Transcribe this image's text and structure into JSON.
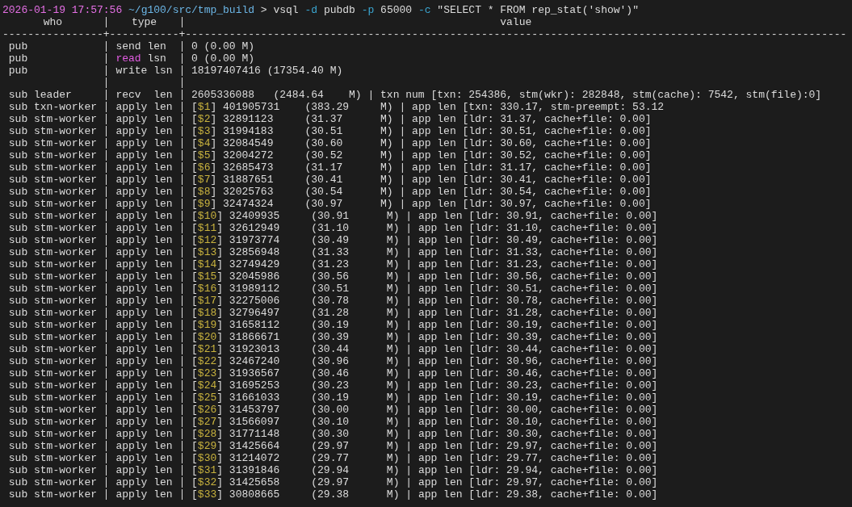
{
  "prompt": {
    "timestamp": "2026-01-19 17:57:56",
    "path": "~/g100/src/tmp_build",
    "symbol": ">",
    "command": [
      {
        "text": "vsql ",
        "kind": "plain"
      },
      {
        "text": "-d",
        "kind": "flag"
      },
      {
        "text": " pubdb ",
        "kind": "plain"
      },
      {
        "text": "-p",
        "kind": "flag"
      },
      {
        "text": " 65000 ",
        "kind": "plain"
      },
      {
        "text": "-c",
        "kind": "flag"
      },
      {
        "text": " \"SELECT * FROM rep_stat('show')\"",
        "kind": "plain"
      }
    ]
  },
  "table": {
    "columns": [
      "who",
      "type",
      "value"
    ],
    "rule": "----------------+-----------+---------------------------------------------------------------------------------------------------------",
    "rows": [
      {
        "kind": "data",
        "who": "pub",
        "type": "send len",
        "value": "0 (0.00 M)"
      },
      {
        "kind": "data",
        "who": "pub",
        "type": [
          {
            "text": "read",
            "kind": "keyword"
          },
          {
            "text": " lsn",
            "kind": "plain"
          }
        ],
        "value": "0 (0.00 M)"
      },
      {
        "kind": "data",
        "who": "pub",
        "type": "write lsn",
        "value": "18197407416 (17354.40 M)"
      },
      {
        "kind": "blank"
      },
      {
        "kind": "data",
        "who": "sub leader",
        "type": "recv  len",
        "value": "2605336088   (2484.64    M) | txn num [txn: 254386, stm(wkr): 282848, stm(cache): 7542, stm(file):0]"
      },
      {
        "kind": "data",
        "who": "sub txn-worker",
        "type": "apply len",
        "value": [
          {
            "text": "[",
            "kind": "plain"
          },
          {
            "text": "$1",
            "kind": "param"
          },
          {
            "text": "] 401905731    (383.29     M) | app len [txn: 330.17, stm-preempt: 53.12",
            "kind": "plain"
          }
        ]
      },
      {
        "kind": "data",
        "who": "sub stm-worker",
        "type": "apply len",
        "value": [
          {
            "text": "[",
            "kind": "plain"
          },
          {
            "text": "$2",
            "kind": "param"
          },
          {
            "text": "] 32891123     (31.37      M) | app len [ldr: 31.37, cache+file: 0.00]",
            "kind": "plain"
          }
        ]
      },
      {
        "kind": "data",
        "who": "sub stm-worker",
        "type": "apply len",
        "value": [
          {
            "text": "[",
            "kind": "plain"
          },
          {
            "text": "$3",
            "kind": "param"
          },
          {
            "text": "] 31994183     (30.51      M) | app len [ldr: 30.51, cache+file: 0.00]",
            "kind": "plain"
          }
        ]
      },
      {
        "kind": "data",
        "who": "sub stm-worker",
        "type": "apply len",
        "value": [
          {
            "text": "[",
            "kind": "plain"
          },
          {
            "text": "$4",
            "kind": "param"
          },
          {
            "text": "] 32084549     (30.60      M) | app len [ldr: 30.60, cache+file: 0.00]",
            "kind": "plain"
          }
        ]
      },
      {
        "kind": "data",
        "who": "sub stm-worker",
        "type": "apply len",
        "value": [
          {
            "text": "[",
            "kind": "plain"
          },
          {
            "text": "$5",
            "kind": "param"
          },
          {
            "text": "] 32004272     (30.52      M) | app len [ldr: 30.52, cache+file: 0.00]",
            "kind": "plain"
          }
        ]
      },
      {
        "kind": "data",
        "who": "sub stm-worker",
        "type": "apply len",
        "value": [
          {
            "text": "[",
            "kind": "plain"
          },
          {
            "text": "$6",
            "kind": "param"
          },
          {
            "text": "] 32685473     (31.17      M) | app len [ldr: 31.17, cache+file: 0.00]",
            "kind": "plain"
          }
        ]
      },
      {
        "kind": "data",
        "who": "sub stm-worker",
        "type": "apply len",
        "value": [
          {
            "text": "[",
            "kind": "plain"
          },
          {
            "text": "$7",
            "kind": "param"
          },
          {
            "text": "] 31887651     (30.41      M) | app len [ldr: 30.41, cache+file: 0.00]",
            "kind": "plain"
          }
        ]
      },
      {
        "kind": "data",
        "who": "sub stm-worker",
        "type": "apply len",
        "value": [
          {
            "text": "[",
            "kind": "plain"
          },
          {
            "text": "$8",
            "kind": "param"
          },
          {
            "text": "] 32025763     (30.54      M) | app len [ldr: 30.54, cache+file: 0.00]",
            "kind": "plain"
          }
        ]
      },
      {
        "kind": "data",
        "who": "sub stm-worker",
        "type": "apply len",
        "value": [
          {
            "text": "[",
            "kind": "plain"
          },
          {
            "text": "$9",
            "kind": "param"
          },
          {
            "text": "] 32474324     (30.97      M) | app len [ldr: 30.97, cache+file: 0.00]",
            "kind": "plain"
          }
        ]
      },
      {
        "kind": "data",
        "who": "sub stm-worker",
        "type": "apply len",
        "value": [
          {
            "text": "[",
            "kind": "plain"
          },
          {
            "text": "$10",
            "kind": "param"
          },
          {
            "text": "] 32409935     (30.91      M) | app len [ldr: 30.91, cache+file: 0.00]",
            "kind": "plain"
          }
        ]
      },
      {
        "kind": "data",
        "who": "sub stm-worker",
        "type": "apply len",
        "value": [
          {
            "text": "[",
            "kind": "plain"
          },
          {
            "text": "$11",
            "kind": "param"
          },
          {
            "text": "] 32612949     (31.10      M) | app len [ldr: 31.10, cache+file: 0.00]",
            "kind": "plain"
          }
        ]
      },
      {
        "kind": "data",
        "who": "sub stm-worker",
        "type": "apply len",
        "value": [
          {
            "text": "[",
            "kind": "plain"
          },
          {
            "text": "$12",
            "kind": "param"
          },
          {
            "text": "] 31973774     (30.49      M) | app len [ldr: 30.49, cache+file: 0.00]",
            "kind": "plain"
          }
        ]
      },
      {
        "kind": "data",
        "who": "sub stm-worker",
        "type": "apply len",
        "value": [
          {
            "text": "[",
            "kind": "plain"
          },
          {
            "text": "$13",
            "kind": "param"
          },
          {
            "text": "] 32856948     (31.33      M) | app len [ldr: 31.33, cache+file: 0.00]",
            "kind": "plain"
          }
        ]
      },
      {
        "kind": "data",
        "who": "sub stm-worker",
        "type": "apply len",
        "value": [
          {
            "text": "[",
            "kind": "plain"
          },
          {
            "text": "$14",
            "kind": "param"
          },
          {
            "text": "] 32749429     (31.23      M) | app len [ldr: 31.23, cache+file: 0.00]",
            "kind": "plain"
          }
        ]
      },
      {
        "kind": "data",
        "who": "sub stm-worker",
        "type": "apply len",
        "value": [
          {
            "text": "[",
            "kind": "plain"
          },
          {
            "text": "$15",
            "kind": "param"
          },
          {
            "text": "] 32045986     (30.56      M) | app len [ldr: 30.56, cache+file: 0.00]",
            "kind": "plain"
          }
        ]
      },
      {
        "kind": "data",
        "who": "sub stm-worker",
        "type": "apply len",
        "value": [
          {
            "text": "[",
            "kind": "plain"
          },
          {
            "text": "$16",
            "kind": "param"
          },
          {
            "text": "] 31989112     (30.51      M) | app len [ldr: 30.51, cache+file: 0.00]",
            "kind": "plain"
          }
        ]
      },
      {
        "kind": "data",
        "who": "sub stm-worker",
        "type": "apply len",
        "value": [
          {
            "text": "[",
            "kind": "plain"
          },
          {
            "text": "$17",
            "kind": "param"
          },
          {
            "text": "] 32275006     (30.78      M) | app len [ldr: 30.78, cache+file: 0.00]",
            "kind": "plain"
          }
        ]
      },
      {
        "kind": "data",
        "who": "sub stm-worker",
        "type": "apply len",
        "value": [
          {
            "text": "[",
            "kind": "plain"
          },
          {
            "text": "$18",
            "kind": "param"
          },
          {
            "text": "] 32796497     (31.28      M) | app len [ldr: 31.28, cache+file: 0.00]",
            "kind": "plain"
          }
        ]
      },
      {
        "kind": "data",
        "who": "sub stm-worker",
        "type": "apply len",
        "value": [
          {
            "text": "[",
            "kind": "plain"
          },
          {
            "text": "$19",
            "kind": "param"
          },
          {
            "text": "] 31658112     (30.19      M) | app len [ldr: 30.19, cache+file: 0.00]",
            "kind": "plain"
          }
        ]
      },
      {
        "kind": "data",
        "who": "sub stm-worker",
        "type": "apply len",
        "value": [
          {
            "text": "[",
            "kind": "plain"
          },
          {
            "text": "$20",
            "kind": "param"
          },
          {
            "text": "] 31866671     (30.39      M) | app len [ldr: 30.39, cache+file: 0.00]",
            "kind": "plain"
          }
        ]
      },
      {
        "kind": "data",
        "who": "sub stm-worker",
        "type": "apply len",
        "value": [
          {
            "text": "[",
            "kind": "plain"
          },
          {
            "text": "$21",
            "kind": "param"
          },
          {
            "text": "] 31923013     (30.44      M) | app len [ldr: 30.44, cache+file: 0.00]",
            "kind": "plain"
          }
        ]
      },
      {
        "kind": "data",
        "who": "sub stm-worker",
        "type": "apply len",
        "value": [
          {
            "text": "[",
            "kind": "plain"
          },
          {
            "text": "$22",
            "kind": "param"
          },
          {
            "text": "] 32467240     (30.96      M) | app len [ldr: 30.96, cache+file: 0.00]",
            "kind": "plain"
          }
        ]
      },
      {
        "kind": "data",
        "who": "sub stm-worker",
        "type": "apply len",
        "value": [
          {
            "text": "[",
            "kind": "plain"
          },
          {
            "text": "$23",
            "kind": "param"
          },
          {
            "text": "] 31936567     (30.46      M) | app len [ldr: 30.46, cache+file: 0.00]",
            "kind": "plain"
          }
        ]
      },
      {
        "kind": "data",
        "who": "sub stm-worker",
        "type": "apply len",
        "value": [
          {
            "text": "[",
            "kind": "plain"
          },
          {
            "text": "$24",
            "kind": "param"
          },
          {
            "text": "] 31695253     (30.23      M) | app len [ldr: 30.23, cache+file: 0.00]",
            "kind": "plain"
          }
        ]
      },
      {
        "kind": "data",
        "who": "sub stm-worker",
        "type": "apply len",
        "value": [
          {
            "text": "[",
            "kind": "plain"
          },
          {
            "text": "$25",
            "kind": "param"
          },
          {
            "text": "] 31661033     (30.19      M) | app len [ldr: 30.19, cache+file: 0.00]",
            "kind": "plain"
          }
        ]
      },
      {
        "kind": "data",
        "who": "sub stm-worker",
        "type": "apply len",
        "value": [
          {
            "text": "[",
            "kind": "plain"
          },
          {
            "text": "$26",
            "kind": "param"
          },
          {
            "text": "] 31453797     (30.00      M) | app len [ldr: 30.00, cache+file: 0.00]",
            "kind": "plain"
          }
        ]
      },
      {
        "kind": "data",
        "who": "sub stm-worker",
        "type": "apply len",
        "value": [
          {
            "text": "[",
            "kind": "plain"
          },
          {
            "text": "$27",
            "kind": "param"
          },
          {
            "text": "] 31566097     (30.10      M) | app len [ldr: 30.10, cache+file: 0.00]",
            "kind": "plain"
          }
        ]
      },
      {
        "kind": "data",
        "who": "sub stm-worker",
        "type": "apply len",
        "value": [
          {
            "text": "[",
            "kind": "plain"
          },
          {
            "text": "$28",
            "kind": "param"
          },
          {
            "text": "] 31771148     (30.30      M) | app len [ldr: 30.30, cache+file: 0.00]",
            "kind": "plain"
          }
        ]
      },
      {
        "kind": "data",
        "who": "sub stm-worker",
        "type": "apply len",
        "value": [
          {
            "text": "[",
            "kind": "plain"
          },
          {
            "text": "$29",
            "kind": "param"
          },
          {
            "text": "] 31425664     (29.97      M) | app len [ldr: 29.97, cache+file: 0.00]",
            "kind": "plain"
          }
        ]
      },
      {
        "kind": "data",
        "who": "sub stm-worker",
        "type": "apply len",
        "value": [
          {
            "text": "[",
            "kind": "plain"
          },
          {
            "text": "$30",
            "kind": "param"
          },
          {
            "text": "] 31214072     (29.77      M) | app len [ldr: 29.77, cache+file: 0.00]",
            "kind": "plain"
          }
        ]
      },
      {
        "kind": "data",
        "who": "sub stm-worker",
        "type": "apply len",
        "value": [
          {
            "text": "[",
            "kind": "plain"
          },
          {
            "text": "$31",
            "kind": "param"
          },
          {
            "text": "] 31391846     (29.94      M) | app len [ldr: 29.94, cache+file: 0.00]",
            "kind": "plain"
          }
        ]
      },
      {
        "kind": "data",
        "who": "sub stm-worker",
        "type": "apply len",
        "value": [
          {
            "text": "[",
            "kind": "plain"
          },
          {
            "text": "$32",
            "kind": "param"
          },
          {
            "text": "] 31425658     (29.97      M) | app len [ldr: 29.97, cache+file: 0.00]",
            "kind": "plain"
          }
        ]
      },
      {
        "kind": "data",
        "who": "sub stm-worker",
        "type": "apply len",
        "value": [
          {
            "text": "[",
            "kind": "plain"
          },
          {
            "text": "$33",
            "kind": "param"
          },
          {
            "text": "] 30808665     (29.38      M) | app len [ldr: 29.38, cache+file: 0.00]",
            "kind": "plain"
          }
        ]
      }
    ]
  }
}
